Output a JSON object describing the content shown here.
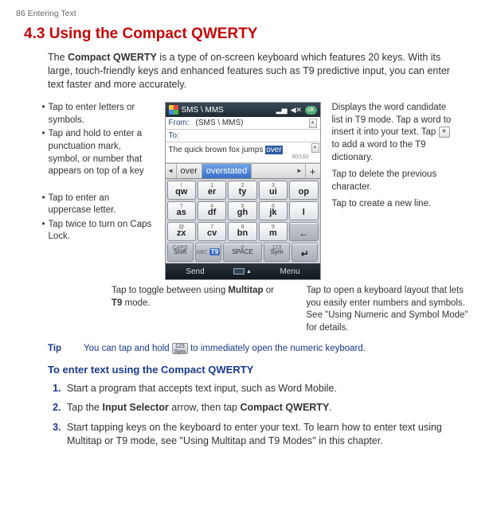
{
  "page_header": "86  Entering Text",
  "heading": "4.3 Using the Compact QWERTY",
  "intro_pre": "The ",
  "intro_bold": "Compact QWERTY",
  "intro_post": " is a type of on-screen keyboard which features 20 keys. With its large, touch-friendly keys and enhanced features such as T9 predictive input, you can enter text faster and more accurately.",
  "left1_a": "Tap to enter letters or symbols.",
  "left1_b": "Tap and hold to enter a punctuation mark, symbol, or number that appears on top of a key",
  "left2_a": "Tap to enter an uppercase letter.",
  "left2_b": "Tap twice to turn on Caps Lock.",
  "right1": "Displays the word candidate list in T9 mode. Tap a word to insert it into your text. Tap ",
  "right1_post": " to add a word to the T9 dictionary.",
  "right2": "Tap to delete the previous character.",
  "right3": "Tap to create a new line.",
  "below_left_pre": "Tap to toggle between using ",
  "below_left_b1": "Multitap",
  "below_left_mid": " or ",
  "below_left_b2": "T9",
  "below_left_post": " mode.",
  "below_right": "Tap to open a keyboard layout that lets you easily enter numbers and symbols. See \"Using Numeric and Symbol Mode\" for details.",
  "tip_label": "Tip",
  "tip_pre": "You can tap and hold ",
  "tip_post": " to immediately open the numeric keyboard.",
  "subhead": "To enter text using the Compact QWERTY",
  "step1": "Start a program that accepts text input, such as Word Mobile.",
  "step2_pre": "Tap the ",
  "step2_b1": "Input Selector",
  "step2_mid": " arrow, then tap ",
  "step2_b2": "Compact QWERTY",
  "step2_post": ".",
  "step3": "Start tapping keys on the keyboard to enter your text. To learn how to enter text using Multitap or T9 mode, see \"Using Multitap and T9 Modes\" in this chapter.",
  "phone": {
    "title": "SMS \\ MMS",
    "ok": "ok",
    "from_lbl": "From:",
    "from_val": "(SMS \\ MMS)",
    "to_lbl": "To:",
    "editor_pre": "The quick brown fox jumps ",
    "editor_sel": "over",
    "counter": "30/160",
    "cand1": "over",
    "cand2": "overstated",
    "keys": {
      "r1": [
        {
          "sup": "!",
          "main": "qw"
        },
        {
          "sup": "1",
          "main": "er"
        },
        {
          "sup": "2",
          "main": "ty"
        },
        {
          "sup": "3",
          "main": "ui"
        },
        {
          "sup": "",
          "main": "op"
        }
      ],
      "r2": [
        {
          "sup": "?",
          "main": "as"
        },
        {
          "sup": "4",
          "main": "df"
        },
        {
          "sup": "5",
          "main": "gh"
        },
        {
          "sup": "6",
          "main": "jk"
        },
        {
          "sup": "",
          "main": "l"
        }
      ],
      "r3": [
        {
          "sup": "@",
          "main": "zx"
        },
        {
          "sup": "7",
          "main": "cv"
        },
        {
          "sup": "8",
          "main": "bn"
        },
        {
          "sup": "9",
          "main": "m"
        },
        {
          "sup": "",
          "main": "←",
          "cls": "bksp dark"
        }
      ],
      "r4": [
        {
          "sup": "CAPS",
          "main": "Shift",
          "cls": "util dark"
        },
        {
          "sup": "",
          "main": "T9",
          "cls": "t9 util dark",
          "abc": "ABC"
        },
        {
          "sup": "0",
          "main": "SPACE",
          "cls": "space util dark"
        },
        {
          "sup": "123",
          "main": "Sym",
          "cls": "util dark"
        },
        {
          "sup": "",
          "main": "↵",
          "cls": "enter dark"
        }
      ]
    },
    "soft_left": "Send",
    "soft_right": "Menu"
  },
  "sym_badge_top": "123",
  "sym_badge_bot": "Sym"
}
